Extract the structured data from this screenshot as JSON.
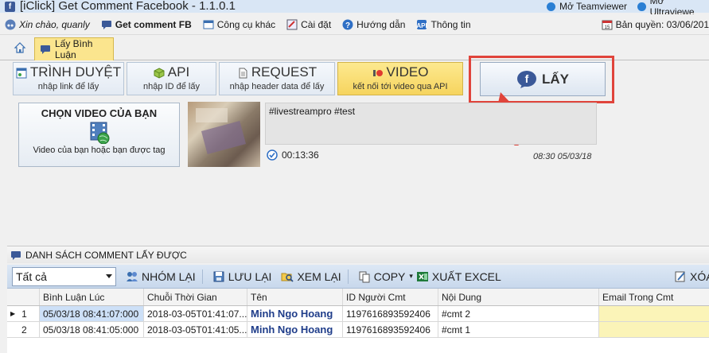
{
  "window": {
    "title": "[iClick] Get Comment Facebook - 1.1.0.1",
    "ext_links": [
      "Mở Teamviewer",
      "Mở Ultraviewe"
    ]
  },
  "menu": {
    "greeting": "Xin chào, quanly",
    "items": [
      "Get comment FB",
      "Công cụ khác",
      "Cài đặt",
      "Hướng dẫn",
      "Thông tin"
    ],
    "license": "Bản quyền: 03/06/201"
  },
  "tab": {
    "label": "Lấy Bình Luận"
  },
  "modes": [
    {
      "title": "TRÌNH DUYỆT",
      "subtitle": "nhập link để lấy"
    },
    {
      "title": "API",
      "subtitle": "nhập ID để lấy"
    },
    {
      "title": "REQUEST",
      "subtitle": "nhập header data để lấy"
    },
    {
      "title": "VIDEO",
      "subtitle": "kết nối tới video qua API"
    }
  ],
  "fetch_button": {
    "label": "LẤY"
  },
  "video_picker": {
    "title": "CHỌN VIDEO CỦA BẠN",
    "subtitle": "Video của bạn hoặc bạn được tag"
  },
  "video": {
    "caption": "#livestreampro #test",
    "duration": "00:13:36",
    "posted": "08:30 05/03/18"
  },
  "section": {
    "title": "DANH SÁCH COMMENT LẤY ĐƯỢC"
  },
  "toolbar": {
    "filter_value": "Tất cả",
    "group": "NHÓM LẠI",
    "save": "LƯU LẠI",
    "review": "XEM LẠI",
    "copy": "COPY",
    "export": "XUẤT EXCEL",
    "delete": "XÓA"
  },
  "grid": {
    "columns": [
      "Bình Luận Lúc",
      "Chuỗi Thời Gian",
      "Tên",
      "ID Người Cmt",
      "Nội Dung",
      "Email Trong Cmt"
    ],
    "rows": [
      {
        "num": "1",
        "time": "05/03/18 08:41:07:000",
        "iso": "2018-03-05T01:41:07...",
        "name": "Minh Ngo Hoang",
        "uid": "1197616893592406",
        "content": "#cmt 2",
        "email": ""
      },
      {
        "num": "2",
        "time": "05/03/18 08:41:05:000",
        "iso": "2018-03-05T01:41:05...",
        "name": "Minh Ngo Hoang",
        "uid": "1197616893592406",
        "content": "#cmt 1",
        "email": ""
      }
    ]
  }
}
